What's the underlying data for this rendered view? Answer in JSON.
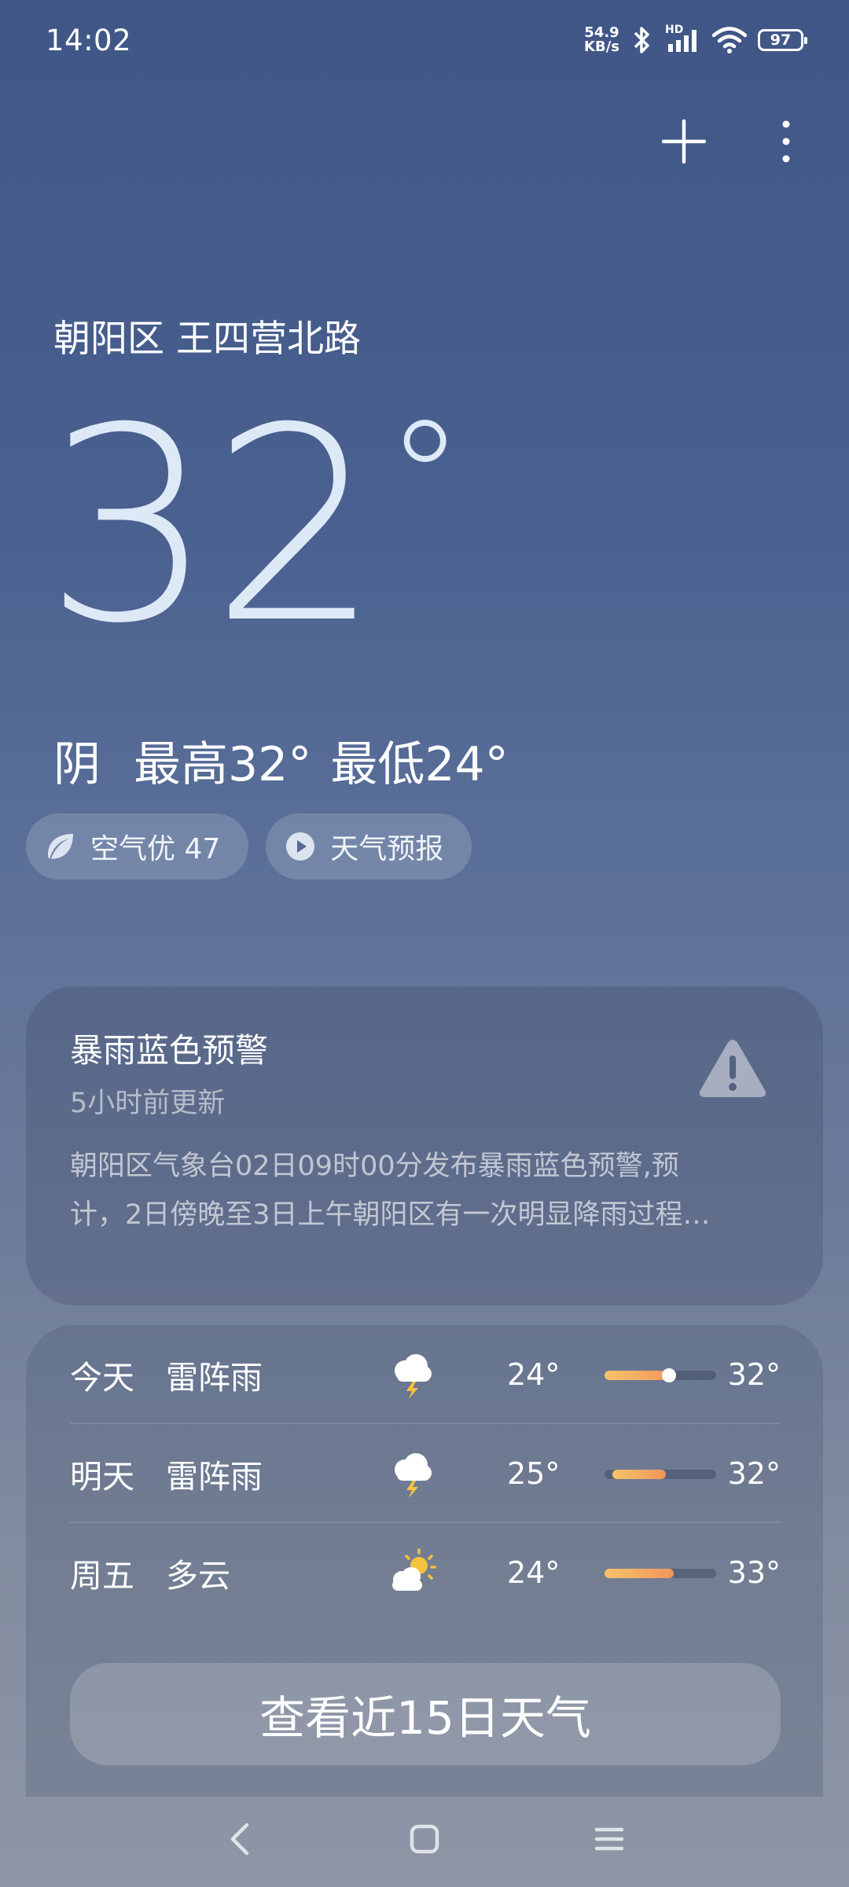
{
  "status_bar": {
    "time": "14:02",
    "net_speed_value": "54.9",
    "net_speed_unit": "KB/s",
    "network_label": "HD",
    "battery_level": "97"
  },
  "header": {
    "icons": [
      "plus-icon",
      "more-vertical-icon"
    ]
  },
  "current": {
    "location": "朝阳区 王四营北路",
    "temperature": "32",
    "temperature_unit": "°",
    "condition": "阴",
    "high": "最高32°",
    "low": "最低24°"
  },
  "chips": {
    "air_quality": "空气优 47",
    "forecast_video": "天气预报"
  },
  "alert": {
    "title": "暴雨蓝色预警",
    "updated": "5小时前更新",
    "line1": "朝阳区气象台02日09时00分发布暴雨蓝色预警,预",
    "line2": "计，2日傍晚至3日上午朝阳区有一次明显降雨过程…"
  },
  "forecast": {
    "days": [
      {
        "day": "今天",
        "condition": "雷阵雨",
        "icon": "thunderstorm-icon",
        "low": "24°",
        "high": "32°",
        "range_start": 0.0,
        "range_end": 0.62,
        "current_pos": 0.58
      },
      {
        "day": "明天",
        "condition": "雷阵雨",
        "icon": "thunderstorm-icon",
        "low": "25°",
        "high": "32°",
        "range_start": 0.07,
        "range_end": 0.55
      },
      {
        "day": "周五",
        "condition": "多云",
        "icon": "partly-cloudy-icon",
        "low": "24°",
        "high": "33°",
        "range_start": 0.0,
        "range_end": 0.62
      }
    ],
    "view_more_label": "查看近15日天气"
  },
  "colors": {
    "background_top": "#3f5686",
    "background_bottom": "#8e96a6",
    "temperature_text": "#dde9f7",
    "bar_warm": "#f0965a",
    "bar_light": "#f6c36b"
  }
}
